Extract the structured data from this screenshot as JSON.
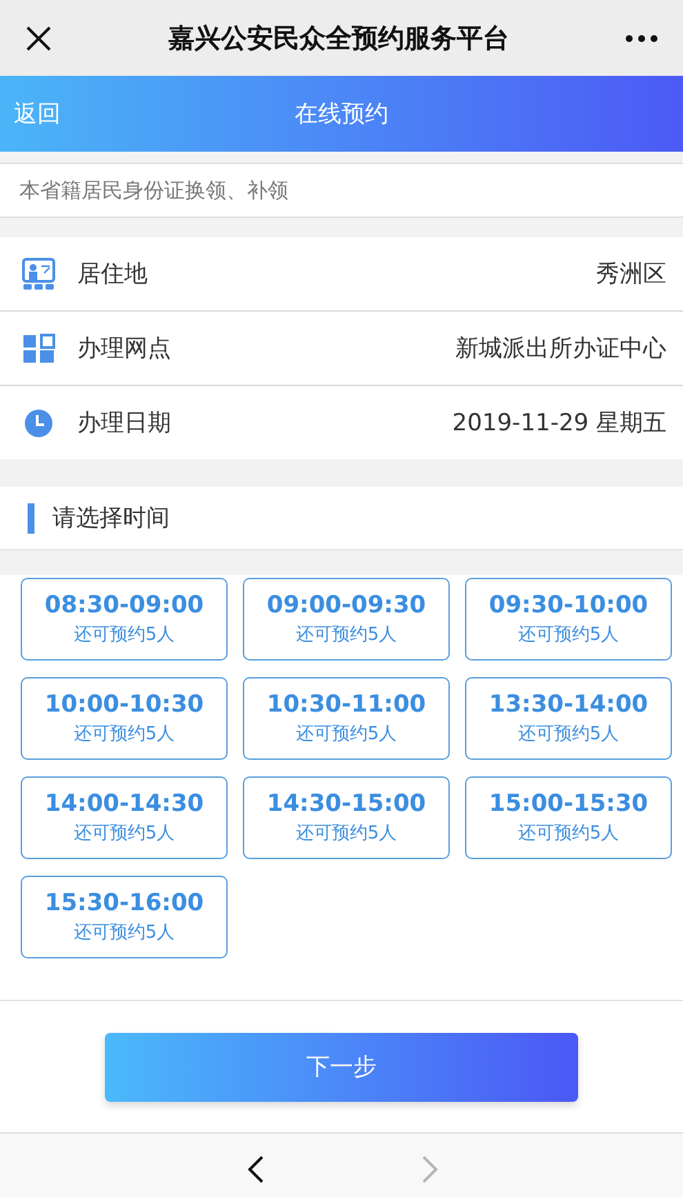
{
  "window": {
    "title": "嘉兴公安民众全预约服务平台"
  },
  "header": {
    "back": "返回",
    "title": "在线预约"
  },
  "service": "本省籍居民身份证换领、补领",
  "fields": [
    {
      "kind": "residence",
      "label": "居住地",
      "value": "秀洲区"
    },
    {
      "kind": "office",
      "label": "办理网点",
      "value": "新城派出所办证中心"
    },
    {
      "kind": "date",
      "label": "办理日期",
      "value": "2019-11-29 星期五"
    }
  ],
  "section_title": "请选择时间",
  "slots": [
    {
      "time": "08:30-09:00",
      "note": "还可预约5人"
    },
    {
      "time": "09:00-09:30",
      "note": "还可预约5人"
    },
    {
      "time": "09:30-10:00",
      "note": "还可预约5人"
    },
    {
      "time": "10:00-10:30",
      "note": "还可预约5人"
    },
    {
      "time": "10:30-11:00",
      "note": "还可预约5人"
    },
    {
      "time": "13:30-14:00",
      "note": "还可预约5人"
    },
    {
      "time": "14:00-14:30",
      "note": "还可预约5人"
    },
    {
      "time": "14:30-15:00",
      "note": "还可预约5人"
    },
    {
      "time": "15:00-15:30",
      "note": "还可预约5人"
    },
    {
      "time": "15:30-16:00",
      "note": "还可预约5人"
    }
  ],
  "next_button": "下一步",
  "browser_nav": [
    {
      "kind": "back",
      "disabled": false
    },
    {
      "kind": "forward",
      "disabled": true
    }
  ]
}
